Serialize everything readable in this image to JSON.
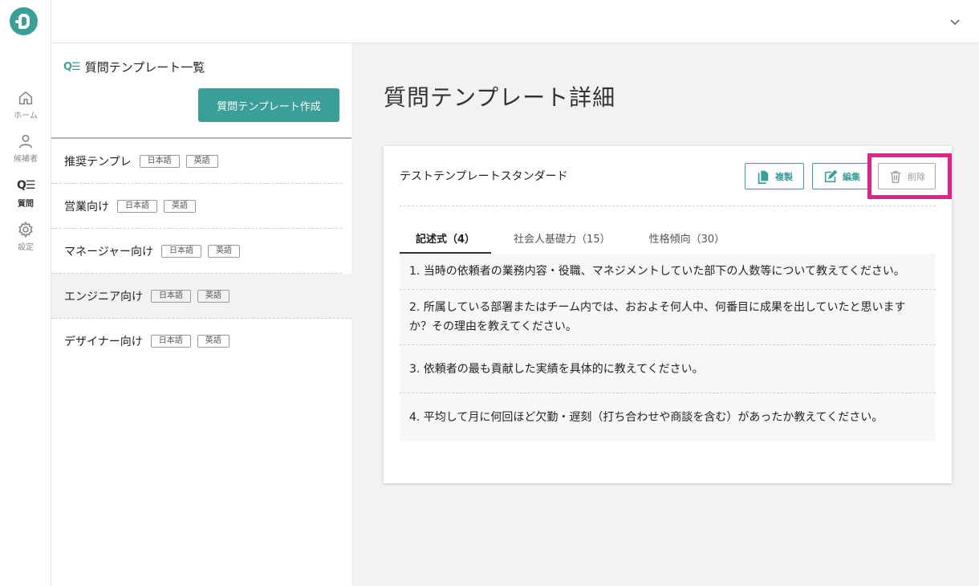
{
  "rail": {
    "items": [
      {
        "label": "ホーム",
        "icon": "home-icon"
      },
      {
        "label": "候補者",
        "icon": "person-icon"
      },
      {
        "label": "質問",
        "icon": "question-list-icon"
      },
      {
        "label": "設定",
        "icon": "gear-icon"
      }
    ],
    "q_glyph": "Q☰"
  },
  "topbar": {
    "menu_icon": "chevron-down-icon"
  },
  "list_panel": {
    "title_glyph": "Q☰",
    "title": "質問テンプレート一覧",
    "create_label": "質問テンプレート作成",
    "items": [
      {
        "name": "推奨テンプレ",
        "tags": [
          "日本語",
          "英語"
        ]
      },
      {
        "name": "営業向け",
        "tags": [
          "日本語",
          "英語"
        ]
      },
      {
        "name": "マネージャー向け",
        "tags": [
          "日本語",
          "英語"
        ]
      },
      {
        "name": "エンジニア向け",
        "tags": [
          "日本語",
          "英語"
        ]
      },
      {
        "name": "デザイナー向け",
        "tags": [
          "日本語",
          "英語"
        ]
      }
    ]
  },
  "main": {
    "page_title": "質問テンプレート詳細",
    "template_name": "テストテンプレートスタンダード",
    "actions": {
      "copy": "複製",
      "edit": "編集",
      "delete": "削除"
    },
    "tabs": [
      {
        "label": "記述式（4）"
      },
      {
        "label": "社会人基礎力（15）"
      },
      {
        "label": "性格傾向（30）"
      }
    ],
    "questions": [
      "1. 当時の依頼者の業務内容・役職、マネジメントしていた部下の人数等について教えてください。",
      "2. 所属している部署またはチーム内では、おおよそ何人中、何番目に成果を出していたと思いますか？その理由を教えてください。",
      "3. 依頼者の最も貢献した実績を具体的に教えてください。",
      "4. 平均して月に何回ほど欠勤・遅刻（打ち合わせや商談を含む）があったか教えてください。"
    ]
  },
  "colors": {
    "accent": "#3a9f98",
    "highlight": "#e91e8c",
    "bg_main": "#f2f2f2"
  }
}
